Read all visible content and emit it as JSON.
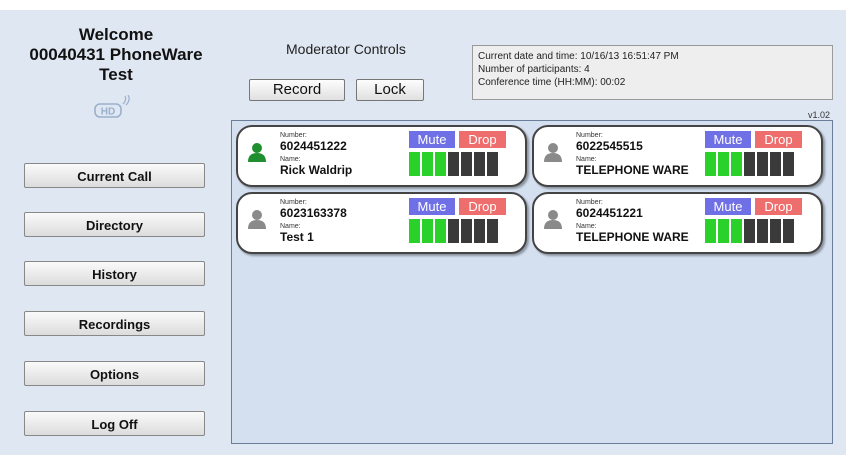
{
  "sidebar": {
    "welcome": "Welcome",
    "account_line": "00040431 PhoneWare",
    "account_name": "Test",
    "logo_text": "HD",
    "nav": [
      {
        "label": "Current Call"
      },
      {
        "label": "Directory"
      },
      {
        "label": "History"
      },
      {
        "label": "Recordings"
      },
      {
        "label": "Options"
      },
      {
        "label": "Log Off"
      }
    ]
  },
  "controls": {
    "title": "Moderator Controls",
    "record_label": "Record",
    "lock_label": "Lock"
  },
  "info": {
    "date_line": "Current date and time: 10/16/13 16:51:47 PM",
    "participants_line": "Number of participants: 4",
    "time_line": "Conference time (HH:MM): 00:02"
  },
  "version": "v1.02",
  "participants": [
    {
      "number_label": "Number:",
      "number": "6024451222",
      "name_label": "Name:",
      "name": "Rick Waldrip",
      "mute_label": "Mute",
      "drop_label": "Drop",
      "level": 3,
      "moderator": true
    },
    {
      "number_label": "Number:",
      "number": "6022545515",
      "name_label": "Name:",
      "name": "TELEPHONE WARE",
      "mute_label": "Mute",
      "drop_label": "Drop",
      "level": 3,
      "moderator": false
    },
    {
      "number_label": "Number:",
      "number": "6023163378",
      "name_label": "Name:",
      "name": "Test 1",
      "mute_label": "Mute",
      "drop_label": "Drop",
      "level": 3,
      "moderator": false
    },
    {
      "number_label": "Number:",
      "number": "6024451221",
      "name_label": "Name:",
      "name": "TELEPHONE WARE",
      "mute_label": "Mute",
      "drop_label": "Drop",
      "level": 3,
      "moderator": false
    }
  ],
  "meter_segments": 7,
  "colors": {
    "meter_on": "#2bd12b",
    "meter_off": "#3a3a3a",
    "mute": "#6f6fe6",
    "drop": "#ee6d6d",
    "moderator_avatar": "#1f8f2f",
    "participant_avatar": "#8a8a8a"
  }
}
